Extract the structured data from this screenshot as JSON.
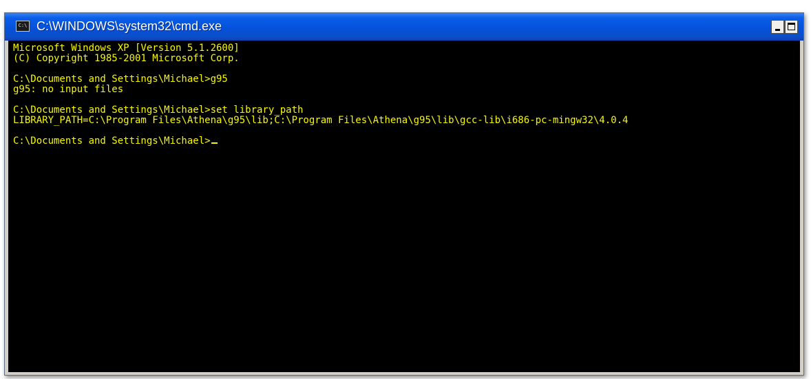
{
  "window": {
    "title": "C:\\WINDOWS\\system32\\cmd.exe",
    "icon_label": "C:\\",
    "icon": "cmd-console-icon",
    "buttons": {
      "minimize_icon": "minimize-icon",
      "maximize_icon": "maximize-icon"
    }
  },
  "console": {
    "text_color": "#f8f800",
    "background_color": "#000000",
    "lines": [
      "Microsoft Windows XP [Version 5.1.2600]",
      "(C) Copyright 1985-2001 Microsoft Corp.",
      "",
      "C:\\Documents and Settings\\Michael>g95",
      "g95: no input files",
      "",
      "C:\\Documents and Settings\\Michael>set library_path",
      "LIBRARY_PATH=C:\\Program Files\\Athena\\g95\\lib;C:\\Program Files\\Athena\\g95\\lib\\gcc-lib\\i686-pc-mingw32\\4.0.4",
      "",
      "C:\\Documents and Settings\\Michael>"
    ]
  }
}
